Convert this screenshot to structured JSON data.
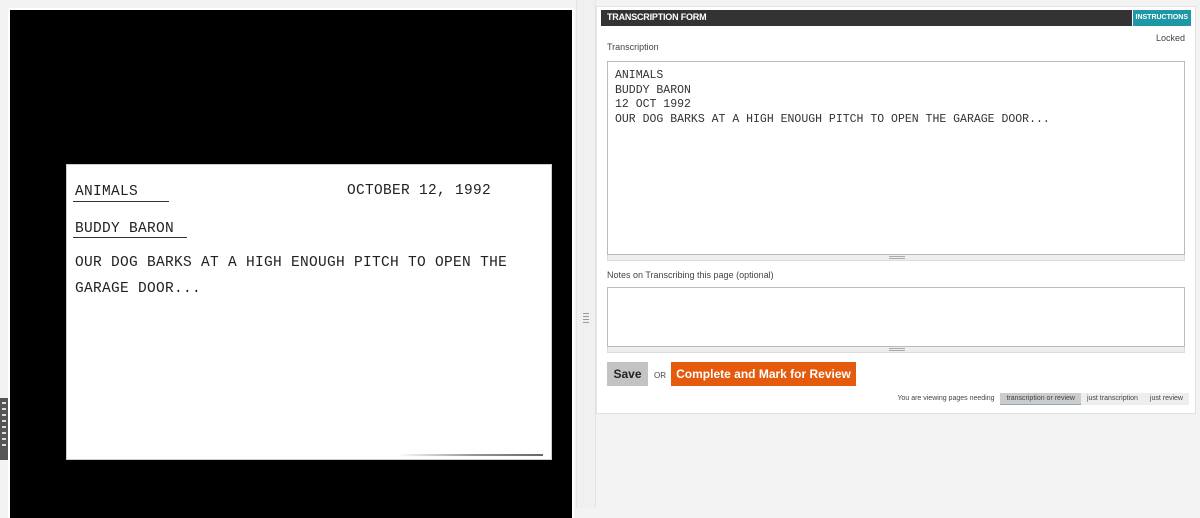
{
  "viewer": {
    "card": {
      "category": "ANIMALS",
      "date": "OCTOBER 12, 1992",
      "author": "BUDDY BARON",
      "line1": "OUR DOG BARKS AT A HIGH ENOUGH PITCH TO OPEN THE",
      "line2": "GARAGE DOOR..."
    }
  },
  "form": {
    "title": "TRANSCRIPTION FORM",
    "instructions_label": "INSTRUCTIONS",
    "status": "Locked",
    "transcription_label": "Transcription",
    "transcription_value": "ANIMALS\nBUDDY BARON\n12 OCT 1992\nOUR DOG BARKS AT A HIGH ENOUGH PITCH TO OPEN THE GARAGE DOOR...",
    "notes_label": "Notes on Transcribing this page (optional)",
    "notes_value": "",
    "save_label": "Save",
    "or_label": "OR",
    "complete_label": "Complete and Mark for Review",
    "filter": {
      "prefix": "You are viewing pages needing",
      "options": [
        "transcription or review",
        "just transcription",
        "just review"
      ],
      "selected": "transcription or review"
    }
  },
  "colors": {
    "accent": "#e45b0d",
    "instructions": "#1f97a6",
    "header": "#333333"
  }
}
